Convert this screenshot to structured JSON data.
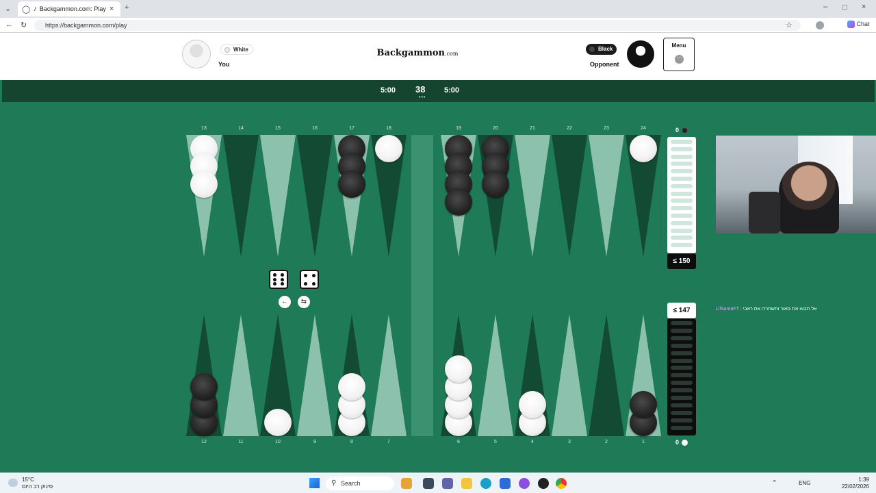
{
  "browser": {
    "tab_title": "Backgammon.com: Play Onlin",
    "url": "https://backgammon.com/play",
    "chat_label": "Chat"
  },
  "header": {
    "logo": "Backgammon",
    "logo_suffix": ".com",
    "player_you": {
      "color_label": "White",
      "name": "You"
    },
    "player_opponent": {
      "color_label": "Black",
      "name": "Opponent"
    },
    "menu_label": "Menu",
    "menu_icon": "⋯"
  },
  "game": {
    "timer_left": "5:00",
    "move_number": "38",
    "move_dots": "•••",
    "timer_right": "5:00",
    "colors": {
      "felt": "#1f7a57",
      "dark_point": "#124a33",
      "light_point": "#8cc1ad",
      "bar": "#3c9170",
      "header_bar": "#15452f"
    },
    "top_labels": [
      "13",
      "14",
      "15",
      "16",
      "17",
      "18",
      "19",
      "20",
      "21",
      "22",
      "23",
      "24"
    ],
    "bottom_labels": [
      "12",
      "11",
      "10",
      "9",
      "8",
      "7",
      "6",
      "5",
      "4",
      "3",
      "2",
      "1"
    ],
    "checkers": {
      "13": {
        "color": "white",
        "count": 3
      },
      "17": {
        "color": "black",
        "count": 3
      },
      "18": {
        "color": "white",
        "count": 1
      },
      "19": {
        "color": "black",
        "count": 4
      },
      "20": {
        "color": "black",
        "count": 3
      },
      "24": {
        "color": "white",
        "count": 1
      },
      "12": {
        "color": "black",
        "count": 3
      },
      "10": {
        "color": "white",
        "count": 1
      },
      "8": {
        "color": "white",
        "count": 3
      },
      "6": {
        "color": "white",
        "count": 4
      },
      "4": {
        "color": "white",
        "count": 2
      },
      "1": {
        "color": "black",
        "count": 2
      }
    },
    "dice": [
      6,
      4
    ],
    "undo_icon": "←",
    "swap_icon": "⇆",
    "opponent_pip": "≤ 150",
    "player_pip": "≤ 147",
    "opponent_off": "0",
    "player_off": "0"
  },
  "stream": {
    "chat_user": "LilSantaFT",
    "chat_message": ": אל תבאו את מאור ותשחררו את ראבי"
  },
  "taskbar": {
    "weather_temp": "15°C",
    "weather_desc": "סינוק רב היום",
    "search_label": "Search",
    "lang": "ENG",
    "time": "1:39",
    "date": "22/02/2026"
  }
}
